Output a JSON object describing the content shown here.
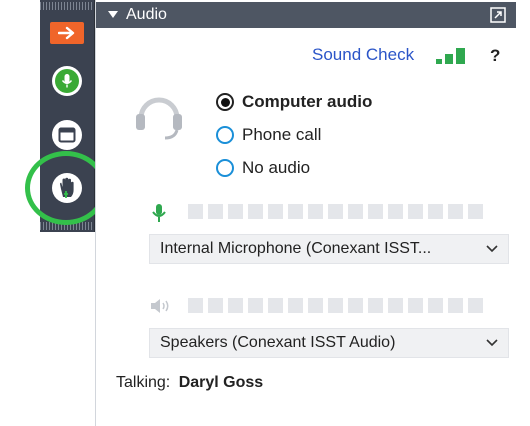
{
  "toolbar": {
    "items": [
      "arrow-right-icon",
      "microphone-icon",
      "window-icon",
      "raise-hand-icon"
    ],
    "arrow_color": "#f0652a",
    "mic_color": "#3aaa35",
    "highlight_color": "#33c04a"
  },
  "panel": {
    "title": "Audio",
    "sound_check_label": "Sound Check",
    "help_label": "?",
    "options": [
      {
        "label": "Computer audio",
        "selected": true
      },
      {
        "label": "Phone call",
        "selected": false
      },
      {
        "label": "No audio",
        "selected": false
      }
    ],
    "microphone": {
      "selected": "Internal  Microphone  (Conexant  ISST...",
      "level": 0
    },
    "speakers": {
      "selected": "Speakers (Conexant ISST Audio)",
      "level": 0
    },
    "talking_label": "Talking:",
    "talking_name": "Daryl Goss"
  }
}
